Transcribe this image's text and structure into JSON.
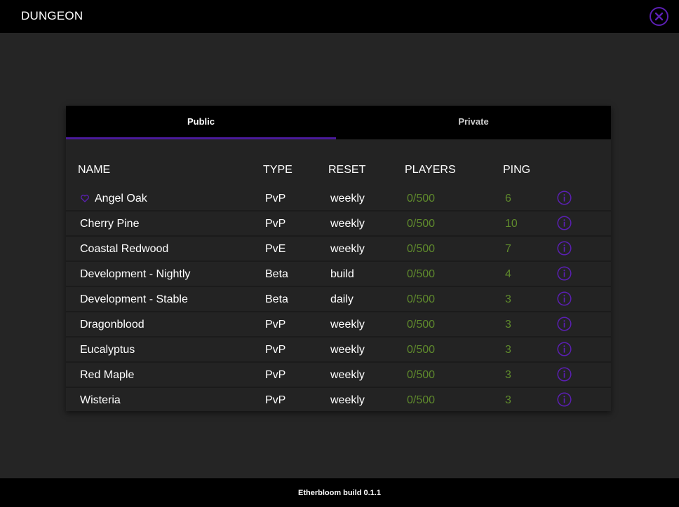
{
  "header": {
    "title": "DUNGEON",
    "close_icon": "close-circle-icon"
  },
  "tabs": [
    {
      "label": "Public",
      "active": true
    },
    {
      "label": "Private",
      "active": false
    }
  ],
  "columns": {
    "name": "NAME",
    "type": "TYPE",
    "reset": "RESET",
    "players": "PLAYERS",
    "ping": "PING"
  },
  "servers": [
    {
      "name": "Angel Oak",
      "favorite": true,
      "type": "PvP",
      "reset": "weekly",
      "players": "0/500",
      "ping": "6"
    },
    {
      "name": "Cherry Pine",
      "favorite": false,
      "type": "PvP",
      "reset": "weekly",
      "players": "0/500",
      "ping": "10"
    },
    {
      "name": "Coastal Redwood",
      "favorite": false,
      "type": "PvE",
      "reset": "weekly",
      "players": "0/500",
      "ping": "7"
    },
    {
      "name": "Development - Nightly",
      "favorite": false,
      "type": "Beta",
      "reset": "build",
      "players": "0/500",
      "ping": "4"
    },
    {
      "name": "Development - Stable",
      "favorite": false,
      "type": "Beta",
      "reset": "daily",
      "players": "0/500",
      "ping": "3"
    },
    {
      "name": "Dragonblood",
      "favorite": false,
      "type": "PvP",
      "reset": "weekly",
      "players": "0/500",
      "ping": "3"
    },
    {
      "name": "Eucalyptus",
      "favorite": false,
      "type": "PvP",
      "reset": "weekly",
      "players": "0/500",
      "ping": "3"
    },
    {
      "name": "Red Maple",
      "favorite": false,
      "type": "PvP",
      "reset": "weekly",
      "players": "0/500",
      "ping": "3"
    },
    {
      "name": "Wisteria",
      "favorite": false,
      "type": "PvP",
      "reset": "weekly",
      "players": "0/500",
      "ping": "3"
    }
  ],
  "footer": {
    "build": "Etherbloom build 0.1.1"
  },
  "colors": {
    "accent": "#5b1fb3",
    "status_green": "#5f8a2c",
    "background": "#252525",
    "bar": "#000000"
  }
}
